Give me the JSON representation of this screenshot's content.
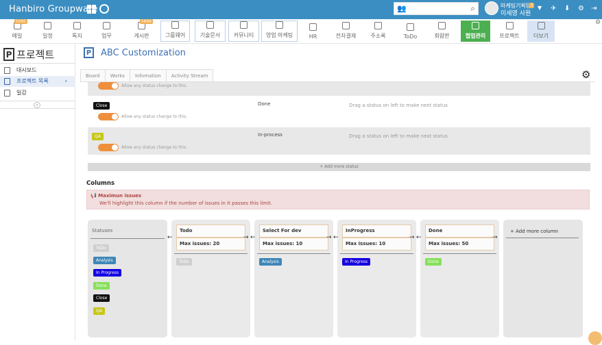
{
  "topbar": {
    "brand": "Hanbiro Groupware",
    "user_dept": "마케팅기획팀",
    "user_name": "이세영 사원",
    "user_badge": "3",
    "accent": "#3b8ec2"
  },
  "toolbar": {
    "items": [
      {
        "label": "메일",
        "icon": "mail-icon",
        "badge": "5095"
      },
      {
        "label": "일정",
        "icon": "calendar-icon"
      },
      {
        "label": "톡지",
        "icon": "chat-icon"
      },
      {
        "label": "업무",
        "icon": "task-icon"
      },
      {
        "label": "게시판",
        "icon": "board-icon",
        "badge": "5899"
      },
      {
        "label": "그룹웨어",
        "icon": "groupware-icon"
      },
      {
        "label": "기술문서",
        "icon": "document-icon"
      },
      {
        "label": "커뮤니티",
        "icon": "community-icon"
      },
      {
        "label": "영업 마케팅",
        "icon": "marketing-icon"
      },
      {
        "label": "HR",
        "icon": "hr-icon"
      },
      {
        "label": "전자결재",
        "icon": "approval-icon"
      },
      {
        "label": "주소록",
        "icon": "addressbook-icon"
      },
      {
        "label": "ToDo",
        "icon": "todo-icon"
      },
      {
        "label": "회람판",
        "icon": "circular-icon"
      },
      {
        "label": "협업관리",
        "icon": "collab-icon"
      },
      {
        "label": "프로젝트",
        "icon": "project-icon"
      },
      {
        "label": "더보기",
        "icon": "more-icon"
      }
    ]
  },
  "sidebar": {
    "title": "프로젝트",
    "items": [
      {
        "label": "대시보드"
      },
      {
        "label": "프로젝트 목록"
      },
      {
        "label": "일감"
      }
    ]
  },
  "main": {
    "title": "ABC Customization",
    "tabs": [
      "Board",
      "Works",
      "Infomation",
      "Activity Stream"
    ],
    "allow_text": "Allow any status change to this.",
    "drag_text": "Drag a status on left to make next status",
    "statuses": [
      {
        "tag": "Close",
        "name": "Done",
        "color": "#111111"
      },
      {
        "tag": "QA",
        "name": "In-process",
        "color": "#c7c71b"
      }
    ],
    "add_status": "+ Add more status",
    "columns_title": "Columns",
    "alert_title": "Maximun issues",
    "alert_body": "We'll highlight this column if the number of issues in it passes this limit.",
    "statuses_panel": {
      "title": "Statuses",
      "tags": [
        {
          "label": "ToDo",
          "color": "#cfcfcf"
        },
        {
          "label": "Analysis",
          "color": "#3f86b8"
        },
        {
          "label": "In Progress",
          "color": "#1400e0"
        },
        {
          "label": "Done",
          "color": "#86e05a"
        },
        {
          "label": "Close",
          "color": "#111111"
        },
        {
          "label": "QA",
          "color": "#c7c71b"
        }
      ]
    },
    "lanes": [
      {
        "name": "Todo",
        "max": "Max issues: 20",
        "tag": "ToDo",
        "tag_color": "#cfcfcf"
      },
      {
        "name": "Select For dev",
        "max": "Max issues: 10",
        "tag": "Analysis",
        "tag_color": "#3f86b8"
      },
      {
        "name": "InProgress",
        "max": "Max issues: 10",
        "tag": "In Progress",
        "tag_color": "#1400e0"
      },
      {
        "name": "Done",
        "max": "Max issues: 50",
        "tag": "Done",
        "tag_color": "#86e05a"
      }
    ],
    "add_column": "+ Add more column"
  }
}
